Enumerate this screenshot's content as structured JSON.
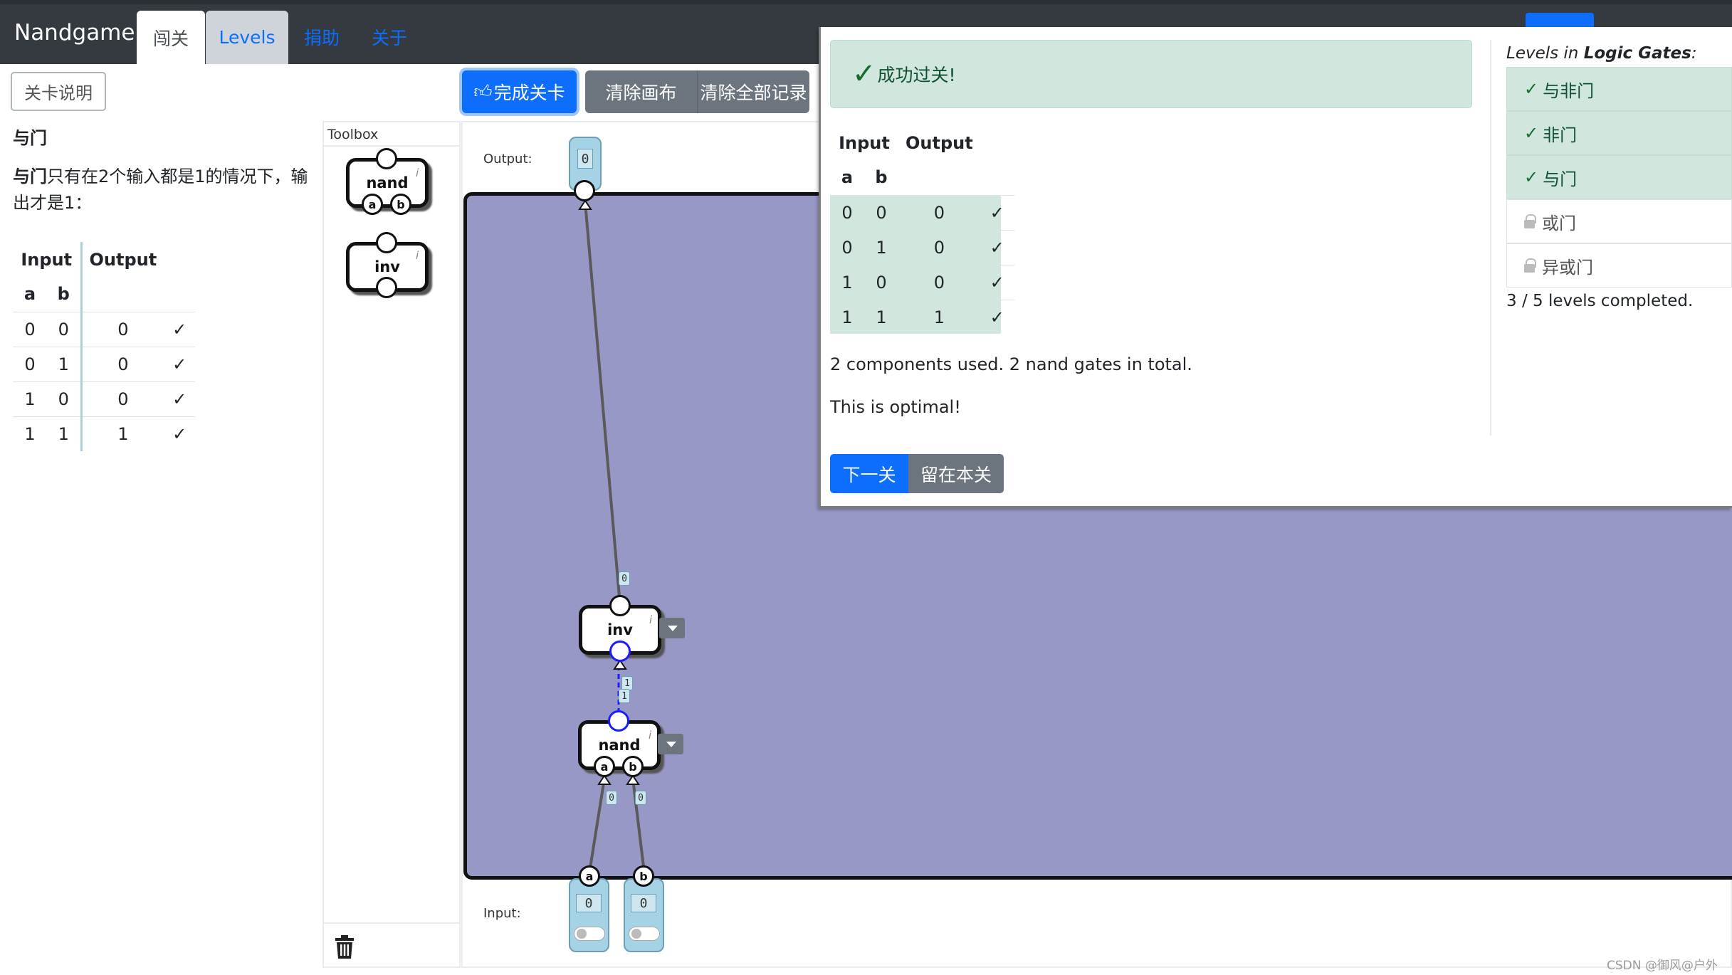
{
  "navbar": {
    "brand": "Nandgame",
    "tabs": [
      "闯关",
      "Levels"
    ],
    "links": [
      "捐助",
      "关于"
    ]
  },
  "left": {
    "help_button": "关卡说明",
    "title": "与门",
    "description_bold": "与门",
    "description_rest": "只有在2个输入都是1的情况下，输出才是1：",
    "table": {
      "input_header": "Input",
      "output_header": "Output",
      "cols": [
        "a",
        "b"
      ],
      "rows": [
        {
          "a": "0",
          "b": "0",
          "out": "0",
          "mark": "✓"
        },
        {
          "a": "0",
          "b": "1",
          "out": "0",
          "mark": "✓"
        },
        {
          "a": "1",
          "b": "0",
          "out": "0",
          "mark": "✓"
        },
        {
          "a": "1",
          "b": "1",
          "out": "1",
          "mark": "✓"
        }
      ]
    }
  },
  "toolbox": {
    "label": "Toolbox",
    "items": [
      {
        "name": "nand",
        "pins": [
          "a",
          "b"
        ]
      },
      {
        "name": "inv"
      }
    ]
  },
  "actions": {
    "complete": "完成关卡",
    "clear_canvas": "清除画布",
    "clear_all": "清除全部记录"
  },
  "canvas": {
    "output_label": "Output:",
    "input_label": "Input:",
    "output_value": "0",
    "inputs": [
      {
        "name": "a",
        "value": "0"
      },
      {
        "name": "b",
        "value": "0"
      }
    ],
    "components": [
      {
        "name": "inv"
      },
      {
        "name": "nand",
        "pins": [
          "a",
          "b"
        ]
      }
    ],
    "wire_values": {
      "inv_to_output": "0",
      "nand_to_inv_1": "1",
      "nand_to_inv_2": "1",
      "a_to_nand": "0",
      "b_to_nand": "0"
    }
  },
  "popup": {
    "success": "成功过关!",
    "table": {
      "input_header": "Input",
      "output_header": "Output",
      "cols": [
        "a",
        "b"
      ],
      "rows": [
        {
          "a": "0",
          "b": "0",
          "out": "0",
          "mark": "✓"
        },
        {
          "a": "0",
          "b": "1",
          "out": "0",
          "mark": "✓"
        },
        {
          "a": "1",
          "b": "0",
          "out": "0",
          "mark": "✓"
        },
        {
          "a": "1",
          "b": "1",
          "out": "1",
          "mark": "✓"
        }
      ]
    },
    "summary": "2 components used. 2 nand gates in total.",
    "optimal": "This is optimal!",
    "next_button": "下一关",
    "stay_button": "留在本关"
  },
  "levels": {
    "header_prefix": "Levels in ",
    "header_group": "Logic Gates",
    "header_suffix": ":",
    "items": [
      {
        "label": "与非门",
        "status": "done"
      },
      {
        "label": "非门",
        "status": "done"
      },
      {
        "label": "与门",
        "status": "done"
      },
      {
        "label": "或门",
        "status": "locked"
      },
      {
        "label": "异或门",
        "status": "locked"
      }
    ],
    "count": "3 / 5 levels completed."
  },
  "watermark": "CSDN @御风@户外",
  "colors": {
    "navbar": "#343a40",
    "primary": "#0d6efd",
    "secondary": "#6c757d",
    "success_bg": "#d1e7dd",
    "board": "#9898c7",
    "io": "#a5d2e5"
  }
}
